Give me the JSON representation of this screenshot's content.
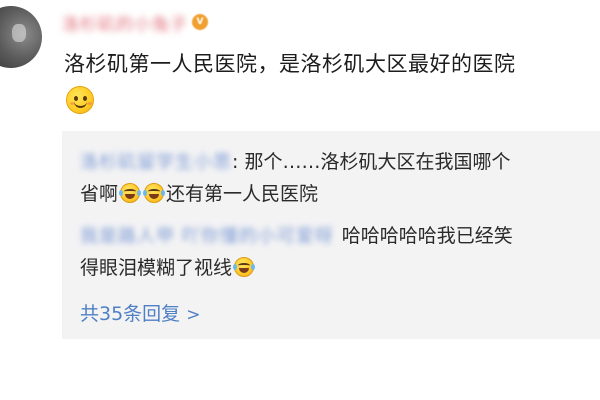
{
  "comment": {
    "username": "洛杉矶的小兔子",
    "badge": "vip",
    "text": "洛杉矶第一人民医院，是洛杉矶大区最好的医院",
    "emoji": "smiley-icon"
  },
  "replies": [
    {
      "username": "洛杉矶留学生小思",
      "segments": [
        {
          "text": ": 那个……洛杉矶大区在我国哪个"
        },
        {
          "text": "省啊"
        },
        {
          "text": "还有第一人民医院"
        }
      ]
    },
    {
      "username": "我是路人甲 吖你懂的小可爱呀",
      "segments": [
        {
          "text": "哈哈哈哈哈我已经笑"
        },
        {
          "text": "得眼泪模糊了视线"
        }
      ]
    }
  ],
  "more_replies": {
    "label": "共35条回复",
    "chevron": ">"
  }
}
